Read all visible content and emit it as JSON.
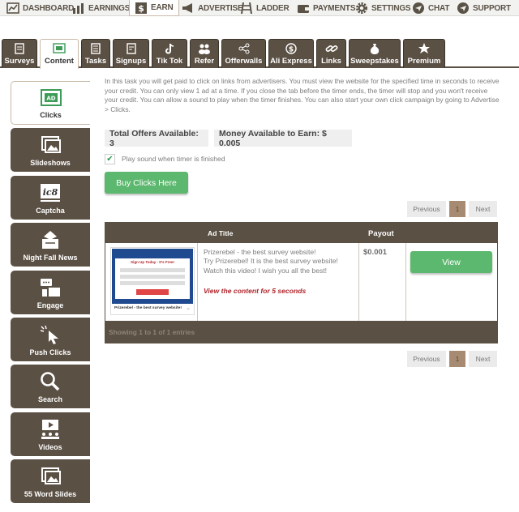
{
  "topnav": [
    {
      "label": "DASHBOARD",
      "icon": "dashboard-chart-icon"
    },
    {
      "label": "EARNINGS",
      "icon": "earnings-bars-icon"
    },
    {
      "label": "EARN",
      "icon": "dollar-icon",
      "active": true
    },
    {
      "label": "ADVERTISE",
      "icon": "megaphone-icon"
    },
    {
      "label": "LADDER",
      "icon": "ladder-icon"
    },
    {
      "label": "PAYMENTS",
      "icon": "wallet-icon"
    },
    {
      "label": "SETTINGS",
      "icon": "gear-icon"
    },
    {
      "label": "CHAT",
      "icon": "chat-icon"
    },
    {
      "label": "SUPPORT",
      "icon": "support-icon"
    }
  ],
  "tabs": [
    {
      "label": "Surveys",
      "icon": "survey-icon"
    },
    {
      "label": "Content",
      "icon": "content-icon",
      "active": true
    },
    {
      "label": "Tasks",
      "icon": "tasks-icon"
    },
    {
      "label": "Signups",
      "icon": "signups-icon"
    },
    {
      "label": "Tik Tok",
      "icon": "tiktok-icon"
    },
    {
      "label": "Refer",
      "icon": "refer-icon"
    },
    {
      "label": "Offerwalls",
      "icon": "offerwalls-icon"
    },
    {
      "label": "Ali Express",
      "icon": "aliexpress-icon"
    },
    {
      "label": "Links",
      "icon": "link-icon"
    },
    {
      "label": "Sweepstakes",
      "icon": "money-bag-icon"
    },
    {
      "label": "Premium",
      "icon": "star-icon"
    }
  ],
  "sidebar": [
    {
      "label": "Clicks",
      "icon": "ad-monitor-icon",
      "active": true
    },
    {
      "label": "Slideshows",
      "icon": "slideshow-icon"
    },
    {
      "label": "Captcha",
      "icon": "captcha-icon"
    },
    {
      "label": "Night Fall News",
      "icon": "news-icon"
    },
    {
      "label": "Engage",
      "icon": "engage-icon"
    },
    {
      "label": "Push Clicks",
      "icon": "cursor-click-icon"
    },
    {
      "label": "Search",
      "icon": "search-icon"
    },
    {
      "label": "Videos",
      "icon": "video-icon"
    },
    {
      "label": "55 Word Slides",
      "icon": "word-slides-icon"
    }
  ],
  "main": {
    "intro": "In this task you will get paid to click on links from advertisers. You must view the website for the specified time in seconds to receive your credit. You can only view 1 ad at a time. If you close the tab before the timer ends, the timer will stop and you won't receive your credit. You can allow a sound to play when the timer finishes. You can also start your own click campaign by going to Advertise > Clicks.",
    "total_offers": "Total Offers Available: 3",
    "money_available": "Money Available to Earn: $ 0.005",
    "sound_checkbox_label": "Play sound when timer is finished",
    "sound_checked": true,
    "buy_button": "Buy Clicks Here",
    "pager": {
      "previous": "Previous",
      "page": "1",
      "next": "Next"
    },
    "table": {
      "col_title": "Ad Title",
      "col_payout": "Payout",
      "row": {
        "title": "Prizerebel - the best survey website!",
        "desc": "Try Prizerebel! It is the best survey website! Watch this video! I wish you all the best!",
        "note": "View the content for 5 seconds",
        "payout": "$0.001",
        "view_button": "View",
        "thumb_caption": "Prizerebel - the best survey website!",
        "thumb_heading": "Sign Up Today - It's Free!"
      },
      "footer": "Showing 1 to 1 of 1 entries"
    }
  },
  "colors": {
    "brown": "#5b5044",
    "green": "#5cb86e",
    "active_page": "#a68b72",
    "note_red": "#b0252b"
  }
}
